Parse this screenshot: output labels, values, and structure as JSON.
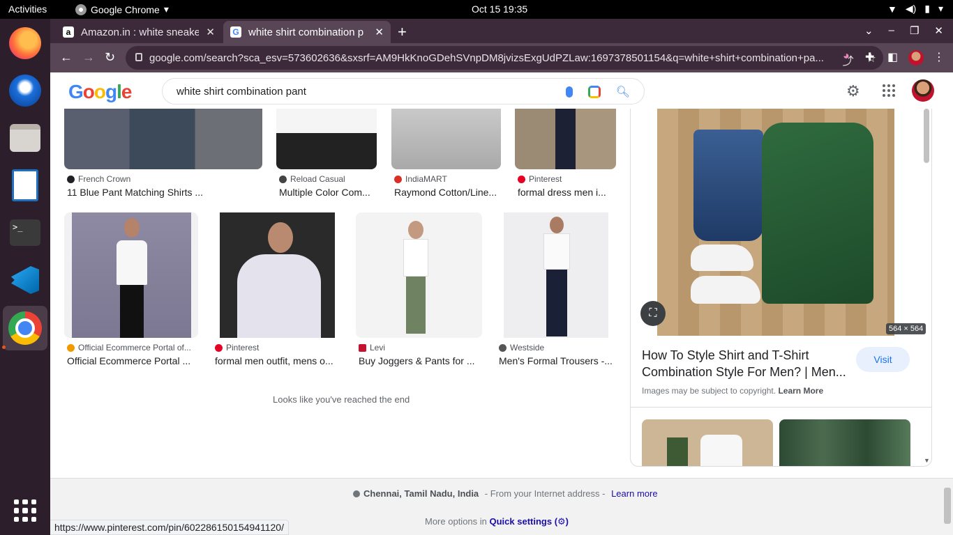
{
  "os": {
    "activities": "Activities",
    "app_name": "Google Chrome",
    "clock": "Oct 15  19:35"
  },
  "browser": {
    "tabs": [
      {
        "title": "Amazon.in : white sneake",
        "active": false
      },
      {
        "title": "white shirt combination p",
        "active": true
      }
    ],
    "url": "google.com/search?sca_esv=573602636&sxsrf=AM9HkKnoGDehSVnpDM8jvizsExgUdPZLaw:1697378501154&q=white+shirt+combination+pa..."
  },
  "google": {
    "logo": "Google",
    "query": "white shirt combination pant"
  },
  "results": {
    "row1": [
      {
        "source": "French Crown",
        "title": "11 Blue Pant Matching Shirts ...",
        "icon_color": "#202124"
      },
      {
        "source": "Reload Casual",
        "title": "Multiple Color Com...",
        "icon_color": "#444444"
      },
      {
        "source": "IndiaMART",
        "title": "Raymond Cotton/Line...",
        "icon_color": "#d93025"
      },
      {
        "source": "Pinterest",
        "title": "formal dress men i...",
        "icon_color": "#e60023"
      }
    ],
    "row2": [
      {
        "source": "Official Ecommerce Portal of...",
        "title": "Official Ecommerce Portal ...",
        "icon_color": "#f29900"
      },
      {
        "source": "Pinterest",
        "title": "formal men outfit, mens o...",
        "icon_color": "#e60023"
      },
      {
        "source": "Levi",
        "title": "Buy Joggers & Pants for ...",
        "icon_color": "#c41230"
      },
      {
        "source": "Westside",
        "title": "Men's Formal Trousers -...",
        "icon_color": "#555555"
      }
    ],
    "end_message": "Looks like you've reached the end"
  },
  "panel": {
    "dimensions": "564 × 564",
    "title": "How To Style Shirt and T-Shirt Combination Style For Men? | Men...",
    "visit_label": "Visit",
    "copyright": "Images may be subject to copyright.",
    "learn_more": "Learn More"
  },
  "footer": {
    "location": "Chennai, Tamil Nadu, India",
    "location_suffix": " - From your Internet address - ",
    "learn_more": "Learn more",
    "more_options": "More options in ",
    "quick_settings": "Quick settings"
  },
  "status_url": "https://www.pinterest.com/pin/602286150154941120/"
}
